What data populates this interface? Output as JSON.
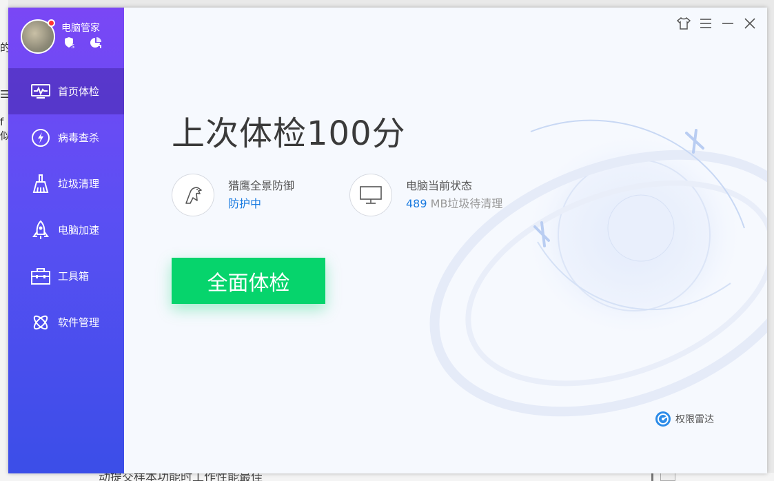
{
  "background": {
    "frag1": "的",
    "frag2": "☰",
    "frag3": "f似",
    "bottom_text": "动提交样本功能时工作性能最佳"
  },
  "app": {
    "name": "电脑管家"
  },
  "nav": {
    "items": [
      {
        "label": "首页体检",
        "icon": "monitor-pulse-icon"
      },
      {
        "label": "病毒查杀",
        "icon": "lightning-shield-icon"
      },
      {
        "label": "垃圾清理",
        "icon": "broom-icon"
      },
      {
        "label": "电脑加速",
        "icon": "rocket-icon"
      },
      {
        "label": "工具箱",
        "icon": "toolbox-icon"
      },
      {
        "label": "软件管理",
        "icon": "apps-icon"
      }
    ]
  },
  "main": {
    "headline": "上次体检100分",
    "defense": {
      "title": "猎鹰全景防御",
      "status": "防护中"
    },
    "pc_state": {
      "title": "电脑当前状态",
      "value": "489",
      "unit": "MB垃圾待清理"
    },
    "scan_button": "全面体检",
    "radar": "权限雷达"
  },
  "colors": {
    "accent_green": "#06d46c",
    "link_blue": "#1a7be0",
    "sidebar_top": "#7a47f5",
    "sidebar_bottom": "#3b4ee8"
  }
}
